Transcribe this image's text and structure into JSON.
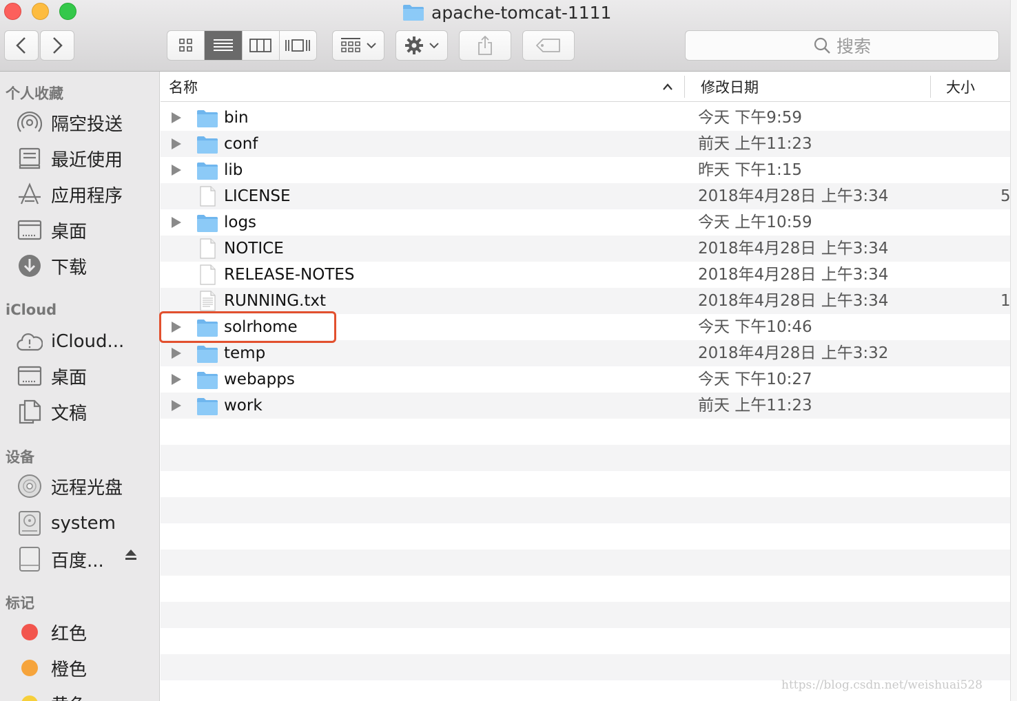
{
  "window": {
    "title": "apache-tomcat-1111"
  },
  "toolbar": {
    "back_icon": "chevron-left-icon",
    "forward_icon": "chevron-right-icon",
    "views": [
      "icon-view",
      "list-view",
      "column-view",
      "cover-flow-view"
    ],
    "active_view": "list-view",
    "search_placeholder": "搜索"
  },
  "sidebar": {
    "favorites_heading": "个人收藏",
    "favorites": [
      {
        "label": "隔空投送",
        "icon": "airdrop-icon"
      },
      {
        "label": "最近使用",
        "icon": "recents-icon"
      },
      {
        "label": "应用程序",
        "icon": "applications-icon"
      },
      {
        "label": "桌面",
        "icon": "desktop-icon"
      },
      {
        "label": "下载",
        "icon": "downloads-icon"
      }
    ],
    "icloud_heading": "iCloud",
    "icloud": [
      {
        "label": "iCloud...",
        "icon": "cloud-icon"
      },
      {
        "label": "桌面",
        "icon": "desktop-icon"
      },
      {
        "label": "文稿",
        "icon": "documents-icon"
      }
    ],
    "devices_heading": "设备",
    "devices": [
      {
        "label": "远程光盘",
        "icon": "disc-icon"
      },
      {
        "label": "system",
        "icon": "hard-drive-icon"
      },
      {
        "label": "百度...",
        "icon": "external-drive-icon"
      }
    ],
    "tags_heading": "标记",
    "tags": [
      {
        "label": "红色",
        "color": "#f2554d"
      },
      {
        "label": "橙色",
        "color": "#f6a43c"
      },
      {
        "label": "黄色",
        "color": "#f6cf3b"
      }
    ]
  },
  "columns": {
    "name": "名称",
    "date": "修改日期",
    "size": "大小"
  },
  "files": [
    {
      "name": "bin",
      "date": "今天 下午9:59",
      "size": "",
      "type": "folder"
    },
    {
      "name": "conf",
      "date": "前天 上午11:23",
      "size": "",
      "type": "folder"
    },
    {
      "name": "lib",
      "date": "昨天 下午1:15",
      "size": "",
      "type": "folder"
    },
    {
      "name": "LICENSE",
      "date": "2018年4月28日 上午3:34",
      "size": "5",
      "type": "file"
    },
    {
      "name": "logs",
      "date": "今天 上午10:59",
      "size": "",
      "type": "folder"
    },
    {
      "name": "NOTICE",
      "date": "2018年4月28日 上午3:34",
      "size": "",
      "type": "file"
    },
    {
      "name": "RELEASE-NOTES",
      "date": "2018年4月28日 上午3:34",
      "size": "",
      "type": "file"
    },
    {
      "name": "RUNNING.txt",
      "date": "2018年4月28日 上午3:34",
      "size": "1",
      "type": "text"
    },
    {
      "name": "solrhome",
      "date": "今天 下午10:46",
      "size": "",
      "type": "folder"
    },
    {
      "name": "temp",
      "date": "2018年4月28日 上午3:32",
      "size": "",
      "type": "folder"
    },
    {
      "name": "webapps",
      "date": "今天 下午10:27",
      "size": "",
      "type": "folder"
    },
    {
      "name": "work",
      "date": "前天 上午11:23",
      "size": "",
      "type": "folder"
    }
  ],
  "highlight_color": "#e2502e",
  "watermark": "https://blog.csdn.net/weishuai528"
}
